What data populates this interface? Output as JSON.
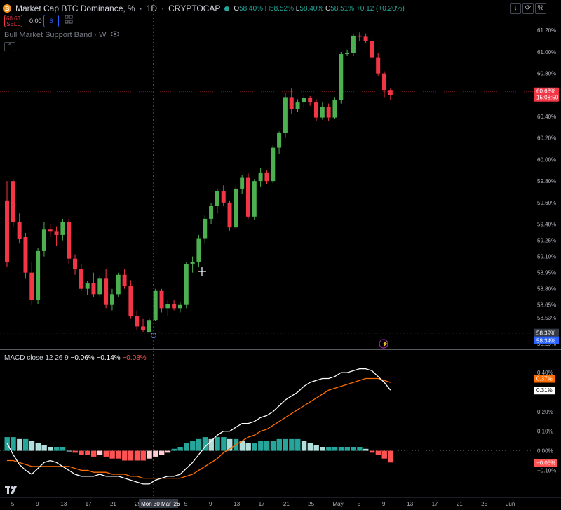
{
  "header": {
    "title": "Market Cap BTC Dominance, %",
    "interval": "1D",
    "source": "CRYPTOCAP",
    "separator": "·",
    "coin_icon": "bitcoin-icon",
    "open_label": "O",
    "open": "58.40%",
    "high_label": "H",
    "high": "58.52%",
    "low_label": "L",
    "low": "58.40%",
    "close_label": "C",
    "close": "58.51%",
    "change": "+0.12 (+0.20%)"
  },
  "trade": {
    "sell_price": "60.63",
    "sell_label": "SELL",
    "spread": "0.00",
    "buy_price": "6"
  },
  "indicator": {
    "label": "Bull Market Support Band · W"
  },
  "toolbar": {
    "download_icon": "↓",
    "scale_label": "%"
  },
  "macd": {
    "label": "MACD close 12 26 9",
    "macd_value": "−0.06%",
    "signal_value": "−0.14%",
    "hist_value": "−0.08%"
  },
  "price_axis": {
    "ticks": [
      "61.20%",
      "61.00%",
      "60.80%",
      "60.63%",
      "60.40%",
      "60.20%",
      "60.00%",
      "59.80%",
      "59.60%",
      "59.40%",
      "59.25%",
      "59.10%",
      "58.95%",
      "58.80%",
      "58.65%",
      "58.53%",
      "58.39%",
      "58.34%",
      "58.29%"
    ],
    "current_price": "60.63%",
    "countdown": "15:08:50",
    "crosshair_price": "58.39%",
    "low_marker": "58.34%"
  },
  "macd_axis": {
    "ticks": [
      "0.40%",
      "0.37%",
      "0.31%",
      "0.20%",
      "0.10%",
      "0.00%",
      "−0.06%",
      "−0.10%"
    ]
  },
  "time_axis": {
    "labels": [
      "5",
      "9",
      "13",
      "17",
      "21",
      "25",
      "Mon 30 Mar '26",
      "5",
      "9",
      "13",
      "17",
      "21",
      "25",
      "May",
      "5",
      "9",
      "13",
      "17",
      "21",
      "25",
      "Jun"
    ]
  },
  "colors": {
    "up": "#26a69a",
    "up_bright": "#4caf50",
    "down": "#f23645",
    "macd_line": "#ffffff",
    "signal_line": "#ff6d00",
    "hist_up_strong": "#26a69a",
    "hist_up_weak": "#b2dfdb",
    "hist_down_strong": "#ff5252",
    "hist_down_weak": "#ffcdd2",
    "bg": "#000000"
  },
  "chart_data": {
    "type": "candlestick",
    "title": "Market Cap BTC Dominance, %",
    "ylabel": "",
    "xlabel": "",
    "ylim": [
      58.29,
      61.26
    ],
    "candles": [
      [
        59.62,
        59.8,
        59.0,
        59.05
      ],
      [
        59.8,
        59.82,
        59.38,
        59.42
      ],
      [
        59.42,
        59.5,
        59.22,
        59.26
      ],
      [
        59.28,
        59.32,
        58.9,
        58.95
      ],
      [
        58.95,
        59.05,
        58.65,
        58.7
      ],
      [
        58.7,
        59.18,
        58.66,
        59.15
      ],
      [
        59.15,
        59.42,
        59.1,
        59.35
      ],
      [
        59.35,
        59.4,
        59.28,
        59.33
      ],
      [
        59.33,
        59.38,
        59.2,
        59.3
      ],
      [
        59.3,
        59.45,
        59.25,
        59.42
      ],
      [
        59.42,
        59.45,
        59.03,
        59.08
      ],
      [
        59.08,
        59.12,
        58.93,
        58.98
      ],
      [
        58.98,
        59.03,
        58.78,
        58.8
      ],
      [
        58.8,
        58.87,
        58.74,
        58.85
      ],
      [
        58.85,
        58.95,
        58.72,
        58.75
      ],
      [
        58.75,
        58.92,
        58.72,
        58.9
      ],
      [
        58.9,
        58.98,
        58.62,
        58.65
      ],
      [
        58.65,
        58.8,
        58.6,
        58.75
      ],
      [
        58.75,
        58.95,
        58.72,
        58.93
      ],
      [
        58.93,
        58.98,
        58.8,
        58.83
      ],
      [
        58.83,
        58.88,
        58.52,
        58.55
      ],
      [
        58.55,
        58.6,
        58.42,
        58.45
      ],
      [
        58.45,
        58.52,
        58.4,
        58.42
      ],
      [
        58.4,
        58.52,
        58.4,
        58.51
      ],
      [
        58.51,
        58.8,
        58.5,
        58.78
      ],
      [
        58.78,
        58.8,
        58.58,
        58.62
      ],
      [
        58.62,
        58.7,
        58.55,
        58.66
      ],
      [
        58.66,
        58.7,
        58.6,
        58.62
      ],
      [
        58.62,
        58.68,
        58.58,
        58.65
      ],
      [
        58.65,
        59.05,
        58.62,
        59.03
      ],
      [
        59.03,
        59.1,
        58.95,
        59.05
      ],
      [
        59.05,
        59.3,
        59.0,
        59.27
      ],
      [
        59.27,
        59.48,
        59.22,
        59.45
      ],
      [
        59.45,
        59.6,
        59.4,
        59.57
      ],
      [
        59.57,
        59.73,
        59.5,
        59.71
      ],
      [
        59.71,
        59.76,
        59.57,
        59.6
      ],
      [
        59.6,
        59.62,
        59.34,
        59.37
      ],
      [
        59.37,
        59.76,
        59.35,
        59.73
      ],
      [
        59.73,
        59.86,
        59.68,
        59.83
      ],
      [
        59.83,
        59.87,
        59.45,
        59.47
      ],
      [
        59.47,
        59.82,
        59.44,
        59.8
      ],
      [
        59.8,
        59.92,
        59.75,
        59.88
      ],
      [
        59.88,
        59.9,
        59.77,
        59.8
      ],
      [
        59.8,
        60.14,
        59.78,
        60.11
      ],
      [
        60.11,
        60.26,
        60.05,
        60.25
      ],
      [
        60.25,
        60.62,
        60.2,
        60.58
      ],
      [
        60.58,
        60.66,
        60.42,
        60.47
      ],
      [
        60.47,
        60.56,
        60.44,
        60.53
      ],
      [
        60.53,
        60.6,
        60.48,
        60.57
      ],
      [
        60.57,
        60.59,
        60.5,
        60.53
      ],
      [
        60.53,
        60.56,
        60.36,
        60.39
      ],
      [
        60.39,
        60.53,
        60.37,
        60.49
      ],
      [
        60.49,
        60.52,
        60.36,
        60.39
      ],
      [
        60.39,
        60.58,
        60.38,
        60.55
      ],
      [
        60.55,
        61.0,
        60.52,
        60.98
      ],
      [
        60.98,
        61.02,
        60.96,
        60.99
      ],
      [
        60.99,
        61.17,
        60.96,
        61.15
      ],
      [
        61.15,
        61.18,
        61.1,
        61.14
      ],
      [
        61.14,
        61.17,
        61.08,
        61.1
      ],
      [
        61.1,
        61.12,
        60.93,
        60.95
      ],
      [
        60.95,
        60.99,
        60.78,
        60.8
      ],
      [
        60.8,
        60.82,
        60.58,
        60.64
      ],
      [
        60.64,
        60.66,
        60.55,
        60.6
      ]
    ],
    "macd_line": [
      0.04,
      -0.02,
      -0.07,
      -0.1,
      -0.12,
      -0.09,
      -0.06,
      -0.05,
      -0.06,
      -0.08,
      -0.1,
      -0.12,
      -0.13,
      -0.13,
      -0.13,
      -0.12,
      -0.13,
      -0.13,
      -0.13,
      -0.14,
      -0.15,
      -0.16,
      -0.17,
      -0.17,
      -0.15,
      -0.14,
      -0.13,
      -0.13,
      -0.12,
      -0.09,
      -0.06,
      -0.02,
      0.02,
      0.05,
      0.08,
      0.1,
      0.1,
      0.12,
      0.14,
      0.14,
      0.15,
      0.17,
      0.18,
      0.2,
      0.23,
      0.26,
      0.28,
      0.3,
      0.33,
      0.35,
      0.36,
      0.37,
      0.37,
      0.38,
      0.4,
      0.4,
      0.41,
      0.42,
      0.42,
      0.41,
      0.38,
      0.35,
      0.31
    ],
    "signal_line": [
      -0.05,
      -0.05,
      -0.06,
      -0.07,
      -0.08,
      -0.08,
      -0.08,
      -0.08,
      -0.08,
      -0.08,
      -0.08,
      -0.09,
      -0.1,
      -0.1,
      -0.11,
      -0.11,
      -0.11,
      -0.12,
      -0.12,
      -0.12,
      -0.13,
      -0.13,
      -0.14,
      -0.14,
      -0.14,
      -0.14,
      -0.14,
      -0.14,
      -0.14,
      -0.13,
      -0.12,
      -0.1,
      -0.08,
      -0.06,
      -0.04,
      -0.01,
      0.01,
      0.03,
      0.05,
      0.07,
      0.08,
      0.1,
      0.11,
      0.13,
      0.15,
      0.17,
      0.19,
      0.21,
      0.23,
      0.25,
      0.27,
      0.29,
      0.31,
      0.32,
      0.33,
      0.34,
      0.35,
      0.36,
      0.37,
      0.37,
      0.37,
      0.36,
      0.35
    ],
    "histogram": [
      0.07,
      0.07,
      0.06,
      0.06,
      0.05,
      0.04,
      0.03,
      0.02,
      0.02,
      0.02,
      0.0,
      -0.01,
      -0.02,
      -0.02,
      -0.03,
      -0.02,
      -0.03,
      -0.04,
      -0.04,
      -0.05,
      -0.05,
      -0.05,
      -0.05,
      -0.04,
      -0.03,
      -0.02,
      -0.01,
      0.01,
      0.02,
      0.04,
      0.05,
      0.06,
      0.07,
      0.06,
      0.07,
      0.07,
      0.06,
      0.06,
      0.05,
      0.04,
      0.04,
      0.05,
      0.05,
      0.05,
      0.06,
      0.06,
      0.06,
      0.06,
      0.05,
      0.04,
      0.03,
      0.02,
      0.02,
      0.02,
      0.02,
      0.02,
      0.02,
      0.02,
      0.01,
      -0.01,
      -0.02,
      -0.04,
      -0.06
    ],
    "macd_ylim": [
      -0.12,
      0.44
    ],
    "grid": false
  }
}
